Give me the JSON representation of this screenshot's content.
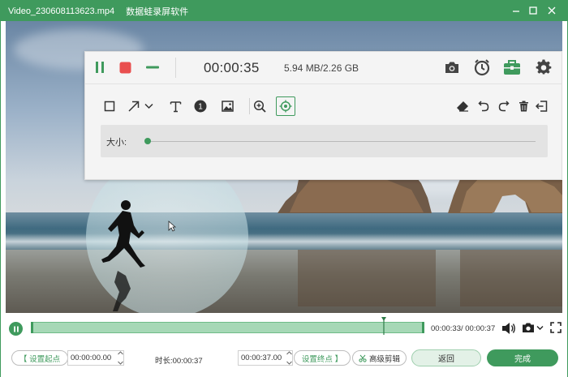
{
  "window": {
    "file_name": "Video_230608113623.mp4",
    "app_name": "数据蛙录屏软件"
  },
  "recorder": {
    "elapsed": "00:00:35",
    "size_used": "5.94 MB/2.26 GB",
    "size_label": "大小:",
    "size_value_fraction": 0.0,
    "badge_number": "1"
  },
  "timeline": {
    "position": "00:00:33",
    "duration": "00:00:37",
    "progress_fraction": 0.9
  },
  "controls": {
    "set_start_label": "设置起点",
    "start_time": "00:00:00.00",
    "duration_label": "时长:",
    "duration_value": "00:00:37",
    "end_time": "00:00:37.00",
    "set_end_label": "设置终点",
    "advanced_label": "高级剪辑",
    "back_label": "返回",
    "done_label": "完成"
  },
  "colors": {
    "brand": "#3f9a5d",
    "stop": "#e94f4f"
  },
  "icons": [
    "minimize-icon",
    "maximize-icon",
    "close-icon",
    "pause-icon",
    "stop-icon",
    "camera-icon",
    "alarm-clock-icon",
    "toolbox-icon",
    "gear-icon",
    "rectangle-icon",
    "arrow-icon",
    "text-icon",
    "number-badge-icon",
    "image-icon",
    "zoom-in-icon",
    "spotlight-icon",
    "eraser-icon",
    "undo-icon",
    "redo-icon",
    "trash-icon",
    "exit-icon",
    "volume-icon",
    "fullscreen-icon"
  ]
}
